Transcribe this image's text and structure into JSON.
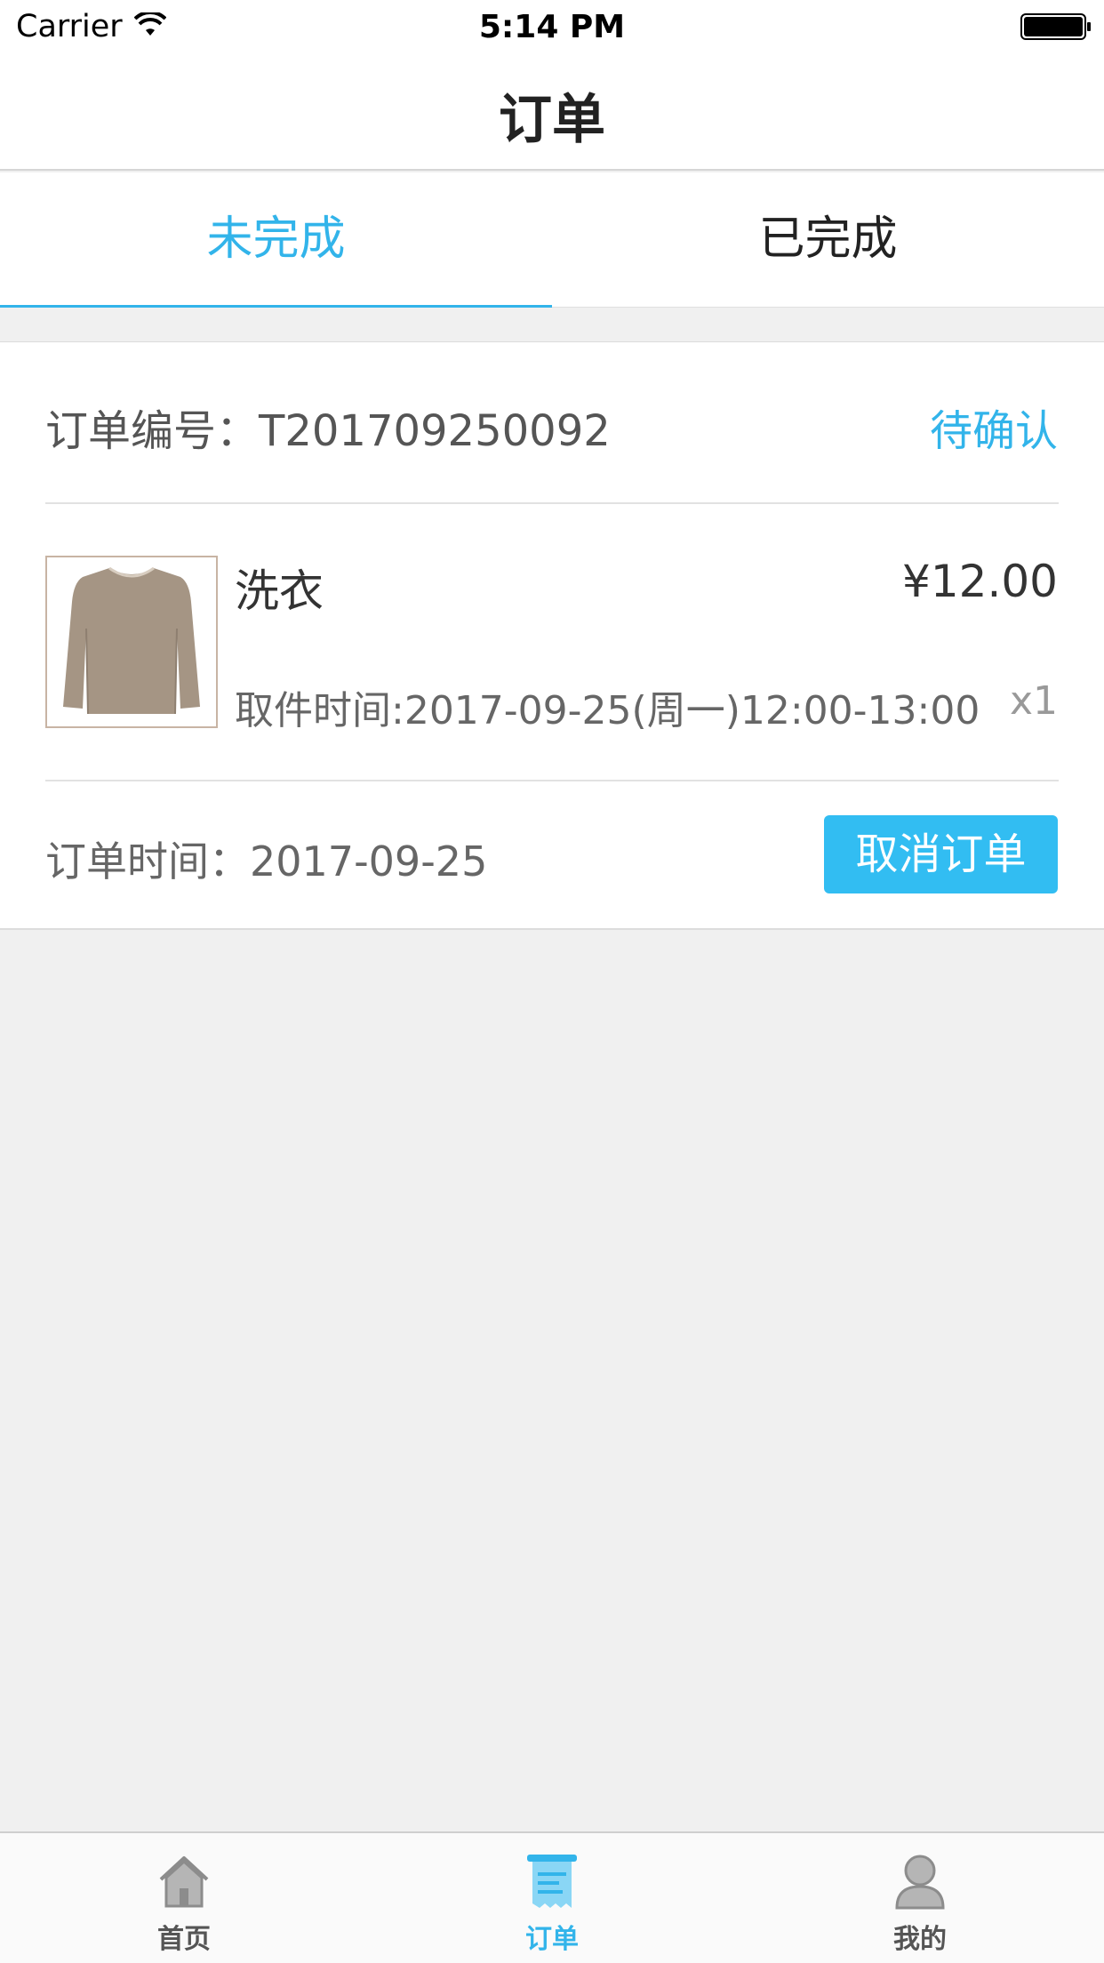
{
  "status_bar": {
    "carrier": "Carrier",
    "time": "5:14 PM"
  },
  "nav": {
    "title": "订单"
  },
  "tabs": [
    {
      "label": "未完成",
      "active": true
    },
    {
      "label": "已完成",
      "active": false
    }
  ],
  "order": {
    "number_label": "订单编号：T201709250092",
    "status": "待确认",
    "item": {
      "name": "洗衣",
      "price": "¥12.00",
      "pickup_time": "取件时间:2017-09-25(周一)12:00-13:00",
      "quantity": "x1",
      "thumbnail_icon": "sweater-image"
    },
    "order_time": "订单时间：2017-09-25",
    "cancel_label": "取消订单"
  },
  "tab_bar": [
    {
      "label": "首页",
      "icon": "home-icon",
      "active": false
    },
    {
      "label": "订单",
      "icon": "order-icon",
      "active": true
    },
    {
      "label": "我的",
      "icon": "profile-icon",
      "active": false
    }
  ],
  "colors": {
    "accent": "#32b4ea",
    "button": "#32bdf2",
    "background": "#f0f0f0"
  }
}
